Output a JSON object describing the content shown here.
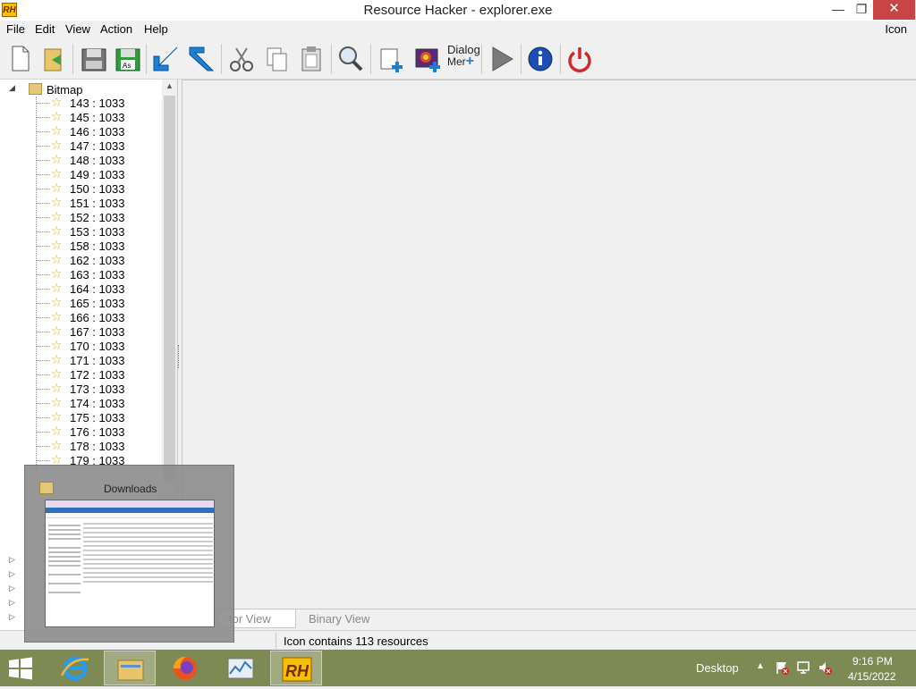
{
  "window": {
    "title": "Resource Hacker - explorer.exe",
    "app_icon_text": "RH",
    "controls": {
      "minimize": "—",
      "restore": "❐",
      "close": "✕"
    }
  },
  "menu": {
    "items": [
      "File",
      "Edit",
      "View",
      "Action",
      "Help"
    ],
    "right_label": "Icon"
  },
  "toolbar": {
    "buttons": [
      "new",
      "open",
      "save",
      "save-as",
      "import",
      "export",
      "cut",
      "copy",
      "paste",
      "find",
      "add-blank-resource",
      "add-image-resource",
      "dialog-merge",
      "compile-run",
      "about",
      "exit"
    ],
    "dialog_label_1": "Dialog",
    "dialog_label_2": "Mer",
    "colors": {
      "accent_blue": "#1e7fd6",
      "power_red": "#d22b2b",
      "save_green": "#2f9b3a"
    }
  },
  "tree": {
    "root_label": "Bitmap",
    "items": [
      "143 : 1033",
      "145 : 1033",
      "146 : 1033",
      "147 : 1033",
      "148 : 1033",
      "149 : 1033",
      "150 : 1033",
      "151 : 1033",
      "152 : 1033",
      "153 : 1033",
      "158 : 1033",
      "162 : 1033",
      "163 : 1033",
      "164 : 1033",
      "165 : 1033",
      "166 : 1033",
      "167 : 1033",
      "170 : 1033",
      "171 : 1033",
      "172 : 1033",
      "173 : 1033",
      "174 : 1033",
      "175 : 1033",
      "176 : 1033",
      "178 : 1033",
      "179 : 1033"
    ]
  },
  "tabs": {
    "editor": "Editor View",
    "editor_visible": "tor View",
    "binary": "Binary View"
  },
  "status": {
    "text": "Icon contains 113 resources"
  },
  "thumbnail": {
    "title": "Downloads"
  },
  "taskbar": {
    "apps": [
      "internet-explorer",
      "file-explorer",
      "firefox",
      "resource-monitor",
      "resource-hacker"
    ],
    "active_app": "file-explorer",
    "desktop_label": "Desktop",
    "time": "9:16 PM",
    "date": "4/15/2022"
  }
}
